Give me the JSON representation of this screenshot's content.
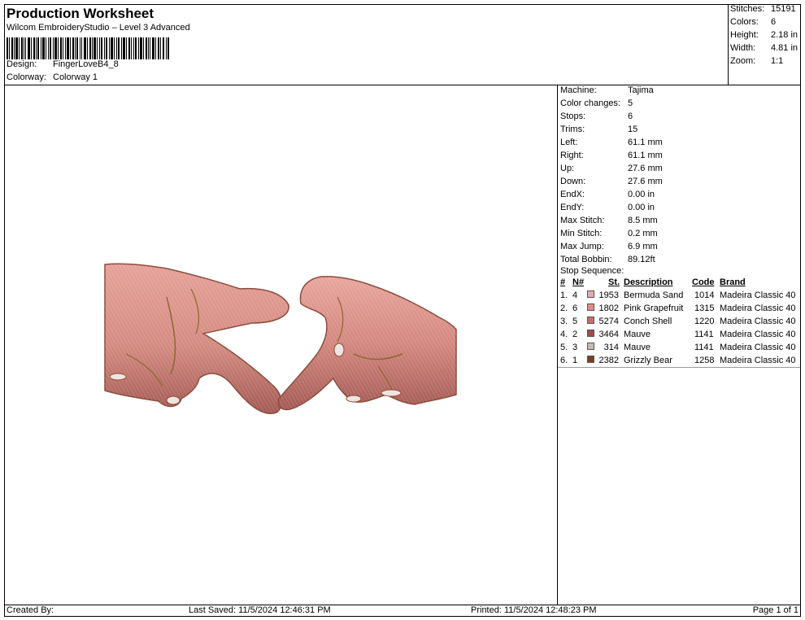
{
  "header": {
    "title": "Production Worksheet",
    "subtitle": "Wilcom EmbroideryStudio – Level 3 Advanced",
    "design_label": "Design:",
    "design_value": "FingerLoveB4_8",
    "colorway_label": "Colorway:",
    "colorway_value": "Colorway 1"
  },
  "summary": {
    "stitches_label": "Stitches:",
    "stitches_value": "15191",
    "colors_label": "Colors:",
    "colors_value": "6",
    "height_label": "Height:",
    "height_value": "2.18 in",
    "width_label": "Width:",
    "width_value": "4.81 in",
    "zoom_label": "Zoom:",
    "zoom_value": "1:1"
  },
  "info": {
    "machine_label": "Machine:",
    "machine_value": "Tajima",
    "color_changes_label": "Color changes:",
    "color_changes_value": "5",
    "stops_label": "Stops:",
    "stops_value": "6",
    "trims_label": "Trims:",
    "trims_value": "15",
    "left_label": "Left:",
    "left_value": "61.1 mm",
    "right_label": "Right:",
    "right_value": "61.1 mm",
    "up_label": "Up:",
    "up_value": "27.6 mm",
    "down_label": "Down:",
    "down_value": "27.6 mm",
    "endx_label": "EndX:",
    "endx_value": "0.00 in",
    "endy_label": "EndY:",
    "endy_value": "0.00 in",
    "max_stitch_label": "Max Stitch:",
    "max_stitch_value": "8.5 mm",
    "min_stitch_label": "Min Stitch:",
    "min_stitch_value": "0.2 mm",
    "max_jump_label": "Max Jump:",
    "max_jump_value": "6.9 mm",
    "total_bobbin_label": "Total Bobbin:",
    "total_bobbin_value": "89.12ft",
    "stop_sequence_label": "Stop Sequence:"
  },
  "stop_table": {
    "headers": {
      "idx": "#",
      "n": "N#",
      "st": "St.",
      "desc": "Description",
      "code": "Code",
      "brand": "Brand"
    },
    "rows": [
      {
        "idx": "1.",
        "n": "4",
        "color": "#e8aab0",
        "st": "1953",
        "desc": "Bermuda Sand",
        "code": "1014",
        "brand": "Madeira Classic 40"
      },
      {
        "idx": "2.",
        "n": "6",
        "color": "#e08c8a",
        "st": "1802",
        "desc": "Pink Grapefruit",
        "code": "1315",
        "brand": "Madeira Classic 40"
      },
      {
        "idx": "3.",
        "n": "5",
        "color": "#c8706e",
        "st": "5274",
        "desc": "Conch Shell",
        "code": "1220",
        "brand": "Madeira Classic 40"
      },
      {
        "idx": "4.",
        "n": "2",
        "color": "#9c4c4e",
        "st": "3464",
        "desc": "Mauve",
        "code": "1141",
        "brand": "Madeira Classic 40"
      },
      {
        "idx": "5.",
        "n": "3",
        "color": "#c9b7b4",
        "st": "314",
        "desc": "Mauve",
        "code": "1141",
        "brand": "Madeira Classic 40"
      },
      {
        "idx": "6.",
        "n": "1",
        "color": "#7a4022",
        "st": "2382",
        "desc": "Grizzly Bear",
        "code": "1258",
        "brand": "Madeira Classic 40"
      }
    ]
  },
  "footer": {
    "created_by": "Created By:",
    "last_saved": "Last Saved: 11/5/2024 12:46:31 PM",
    "printed": "Printed: 11/5/2024 12:48:23 PM",
    "page": "Page 1 of 1"
  }
}
